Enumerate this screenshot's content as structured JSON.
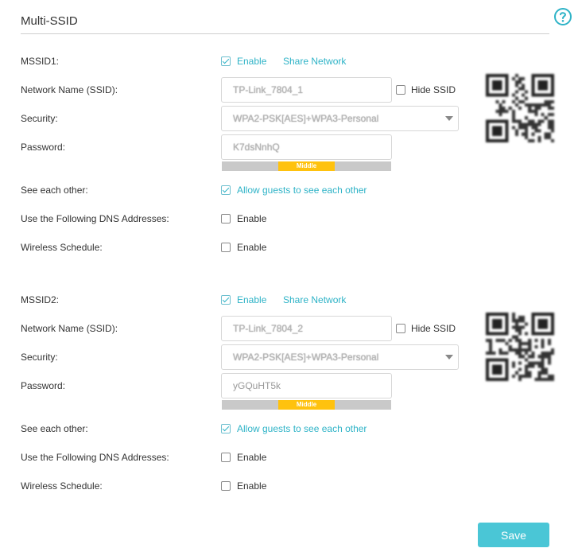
{
  "page": {
    "title": "Multi-SSID"
  },
  "labels": {
    "mssid_prefix": "MSSID",
    "network_name": "Network Name (SSID):",
    "security": "Security:",
    "password": "Password:",
    "see_each_other": "See each other:",
    "dns": "Use the Following DNS Addresses:",
    "schedule": "Wireless Schedule:",
    "enable": "Enable",
    "share_network": "Share Network",
    "hide_ssid": "Hide SSID",
    "allow_guests": "Allow guests to see each other"
  },
  "ssids": [
    {
      "label": "MSSID1:",
      "enabled": true,
      "network_name": "TP-Link_7804_1",
      "hide_ssid": false,
      "security": "WPA2-PSK[AES]+WPA3-Personal",
      "password": "K7dsNnhQ",
      "strength": "Middle",
      "allow_guests": true,
      "dns_enabled": false,
      "schedule_enabled": false
    },
    {
      "label": "MSSID2:",
      "enabled": true,
      "network_name": "TP-Link_7804_2",
      "hide_ssid": false,
      "security": "WPA2-PSK[AES]+WPA3-Personal",
      "password": "yGQuHT5k",
      "strength": "Middle",
      "allow_guests": true,
      "dns_enabled": false,
      "schedule_enabled": false
    }
  ],
  "footer": {
    "save_label": "Save"
  },
  "colors": {
    "accent": "#2eb3c7",
    "button": "#4ac6d6",
    "strength_middle": "#ffc20e"
  },
  "icons": {
    "help": "question-circle-icon",
    "caret": "caret-down-icon"
  }
}
